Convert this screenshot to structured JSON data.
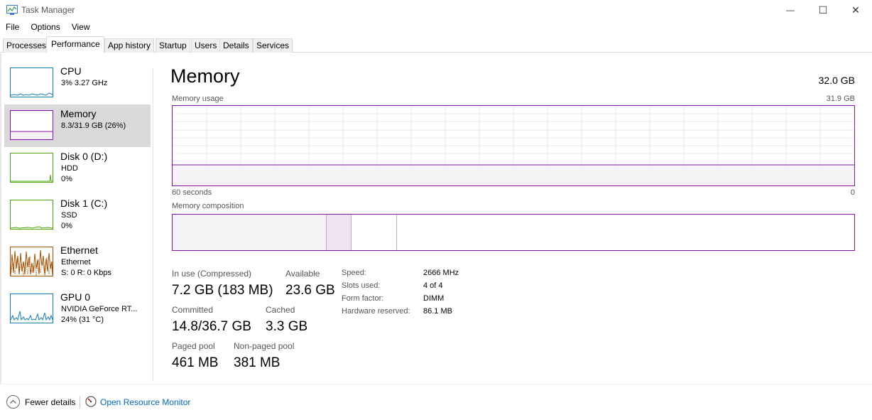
{
  "window": {
    "title": "Task Manager",
    "minimize_glyph": "—",
    "maximize_glyph": "☐",
    "close_glyph": "✕"
  },
  "menu": [
    "File",
    "Options",
    "View"
  ],
  "tabs": [
    "Processes",
    "Performance",
    "App history",
    "Startup",
    "Users",
    "Details",
    "Services"
  ],
  "active_tab": "Performance",
  "sidebar": {
    "items": [
      {
        "title": "CPU",
        "sub1": "3%  3.27 GHz",
        "sub2": "",
        "icon": "cpu-graph-icon",
        "color": "#117dbb"
      },
      {
        "title": "Memory",
        "sub1": "8.3/31.9 GB (26%)",
        "sub2": "",
        "icon": "memory-graph-icon",
        "color": "#8b12ae"
      },
      {
        "title": "Disk 0 (D:)",
        "sub1": "HDD",
        "sub2": "0%",
        "icon": "disk-graph-icon",
        "color": "#4da60c"
      },
      {
        "title": "Disk 1 (C:)",
        "sub1": "SSD",
        "sub2": "0%",
        "icon": "disk-graph-icon",
        "color": "#4da60c"
      },
      {
        "title": "Ethernet",
        "sub1": "Ethernet",
        "sub2": "S: 0  R: 0 Kbps",
        "icon": "network-graph-icon",
        "color": "#a74f01"
      },
      {
        "title": "GPU 0",
        "sub1": "NVIDIA GeForce RT...",
        "sub2": "24%  (31 °C)",
        "icon": "gpu-graph-icon",
        "color": "#117dbb"
      }
    ],
    "selected": "Memory"
  },
  "main": {
    "title": "Memory",
    "total": "32.0 GB",
    "usage_label": "Memory usage",
    "usage_max": "31.9 GB",
    "time_label": "60 seconds",
    "time_end": "0",
    "usage_fraction": 0.26,
    "composition_label": "Memory composition",
    "composition": {
      "in_use_fraction": 0.226,
      "modified_fraction": 0.036,
      "standby_fraction": 0.067
    },
    "stats": {
      "in_use_label": "In use (Compressed)",
      "in_use_value": "7.2 GB (183 MB)",
      "available_label": "Available",
      "available_value": "23.6 GB",
      "committed_label": "Committed",
      "committed_value": "14.8/36.7 GB",
      "cached_label": "Cached",
      "cached_value": "3.3 GB",
      "paged_label": "Paged pool",
      "paged_value": "461 MB",
      "nonpaged_label": "Non-paged pool",
      "nonpaged_value": "381 MB"
    },
    "specs": [
      {
        "label": "Speed:",
        "value": "2666 MHz"
      },
      {
        "label": "Slots used:",
        "value": "4 of 4"
      },
      {
        "label": "Form factor:",
        "value": "DIMM"
      },
      {
        "label": "Hardware reserved:",
        "value": "86.1 MB"
      }
    ]
  },
  "footer": {
    "fewer_details": "Fewer details",
    "open_resource_monitor": "Open Resource Monitor"
  },
  "colors": {
    "memory_accent": "#8b12ae",
    "memory_fill": "#f4f2f4",
    "link": "#0066cc"
  }
}
